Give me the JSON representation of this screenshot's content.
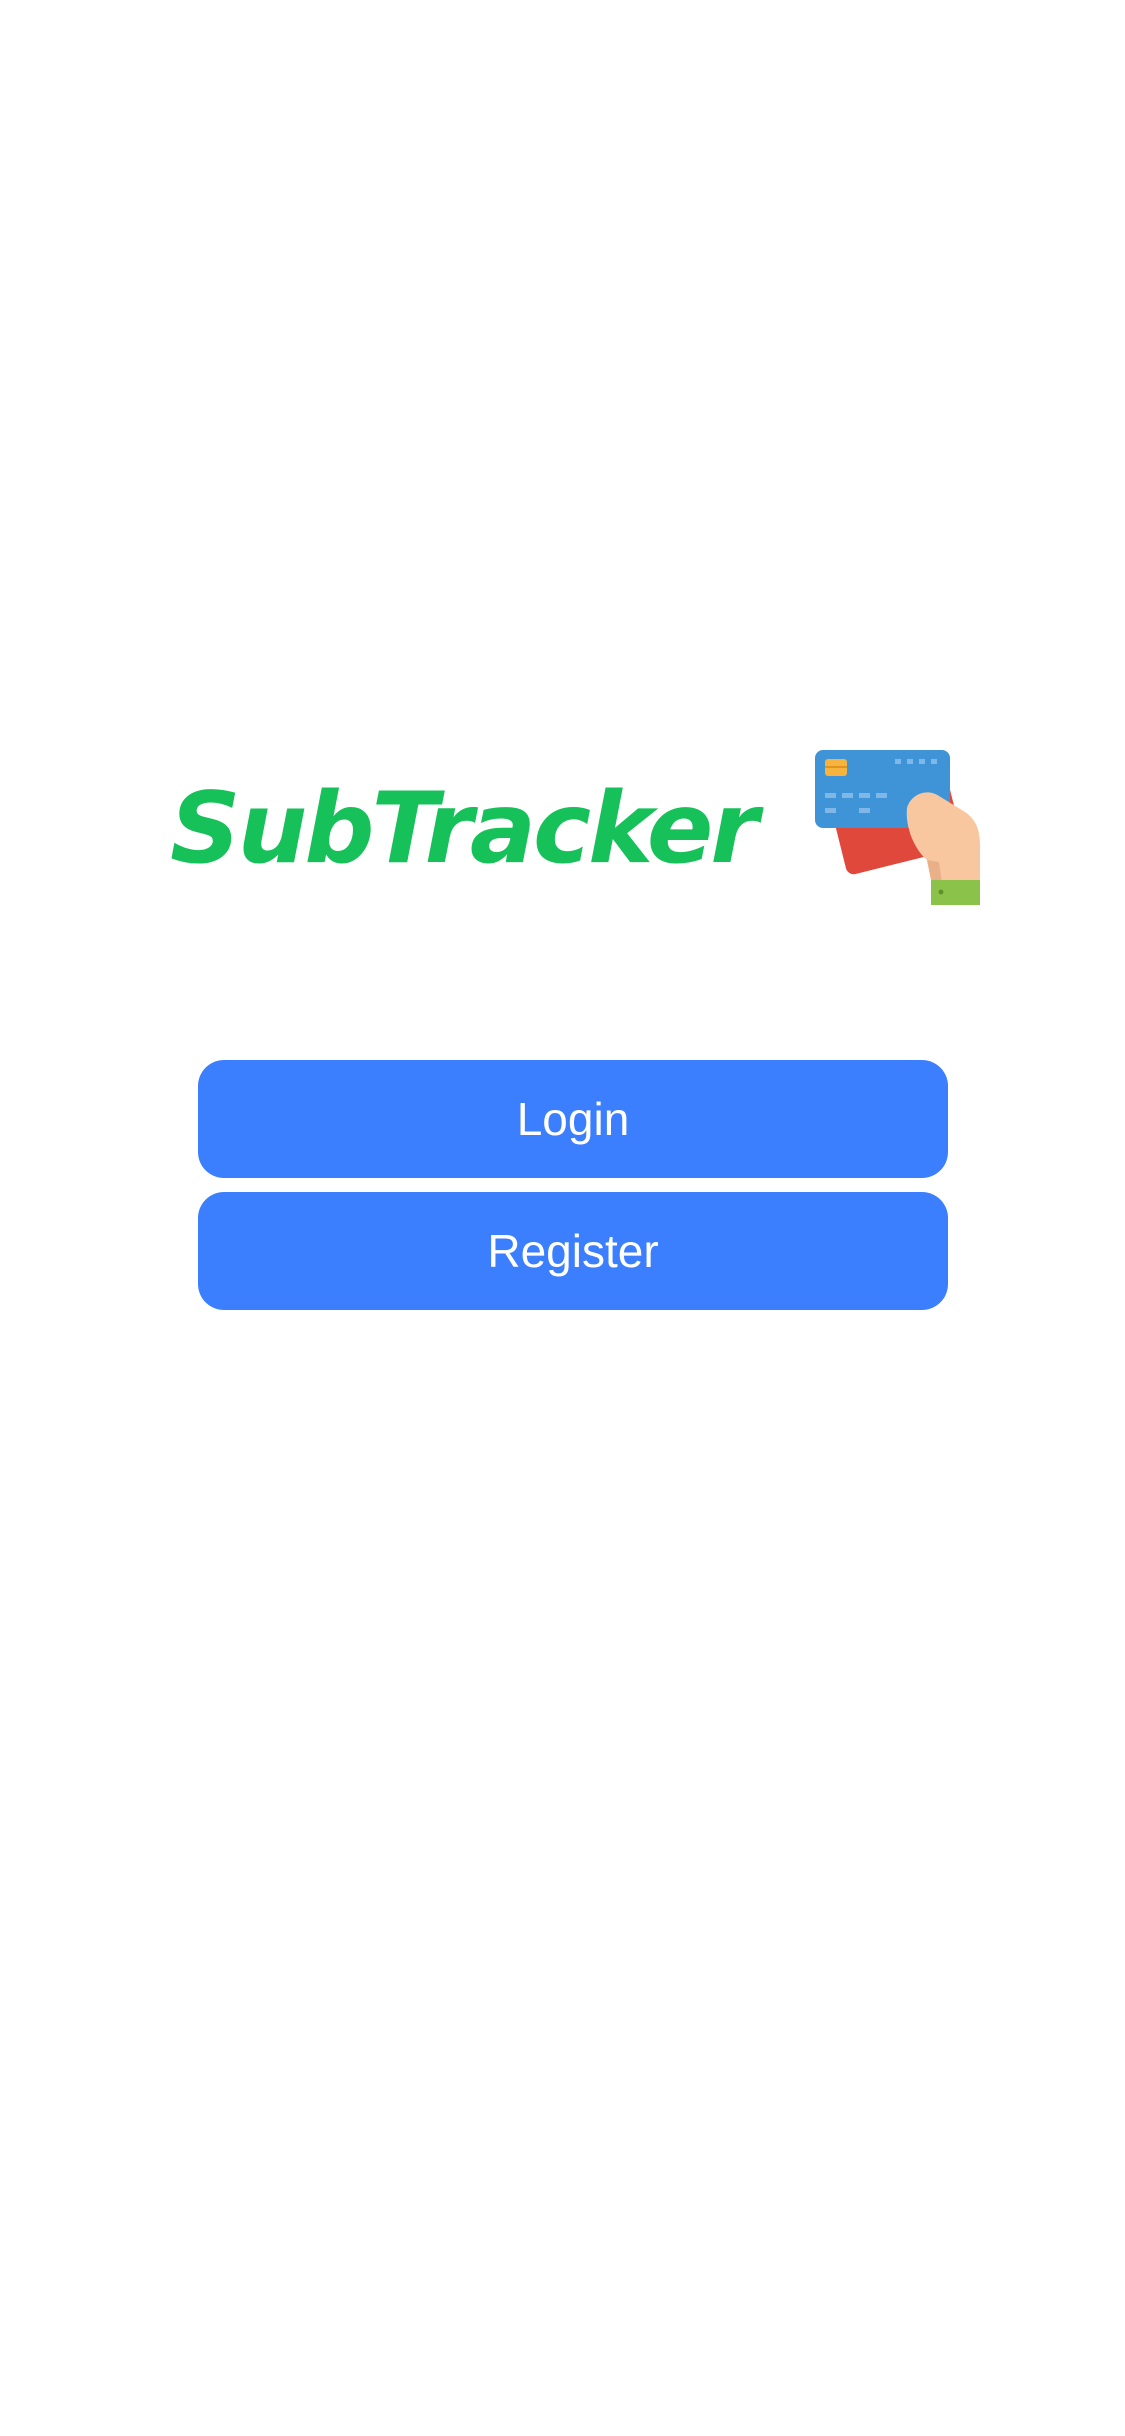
{
  "app": {
    "logo_text": "SubTracker"
  },
  "actions": {
    "login_label": "Login",
    "register_label": "Register"
  },
  "colors": {
    "brand_green": "#16c15a",
    "button_blue": "#3b7fff",
    "button_text": "#ffffff",
    "background": "#ffffff"
  },
  "icons": {
    "logo_illustration": "hand-holding-credit-card-icon"
  }
}
